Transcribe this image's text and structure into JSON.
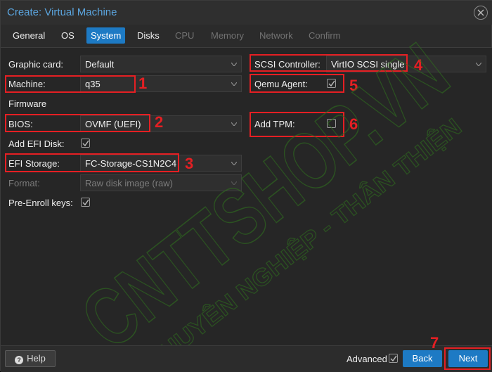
{
  "window": {
    "title": "Create: Virtual Machine"
  },
  "tabs": [
    {
      "label": "General",
      "state": "normal"
    },
    {
      "label": "OS",
      "state": "normal"
    },
    {
      "label": "System",
      "state": "active"
    },
    {
      "label": "Disks",
      "state": "normal"
    },
    {
      "label": "CPU",
      "state": "disabled"
    },
    {
      "label": "Memory",
      "state": "disabled"
    },
    {
      "label": "Network",
      "state": "disabled"
    },
    {
      "label": "Confirm",
      "state": "disabled"
    }
  ],
  "form": {
    "graphic_card": {
      "label": "Graphic card:",
      "value": "Default"
    },
    "machine": {
      "label": "Machine:",
      "value": "q35"
    },
    "firmware_heading": "Firmware",
    "bios": {
      "label": "BIOS:",
      "value": "OVMF (UEFI)"
    },
    "add_efi_disk": {
      "label": "Add EFI Disk:",
      "checked": true
    },
    "efi_storage": {
      "label": "EFI Storage:",
      "value": "FC-Storage-CS1N2C4"
    },
    "format": {
      "label": "Format:",
      "value": "Raw disk image (raw)",
      "disabled": true
    },
    "pre_enroll_keys": {
      "label": "Pre-Enroll keys:",
      "checked": true
    },
    "scsi_controller": {
      "label": "SCSI Controller:",
      "value": "VirtIO SCSI single"
    },
    "qemu_agent": {
      "label": "Qemu Agent:",
      "checked": true
    },
    "add_tpm": {
      "label": "Add TPM:",
      "checked": false
    }
  },
  "annotations": [
    "1",
    "2",
    "3",
    "4",
    "5",
    "6",
    "7"
  ],
  "watermark": {
    "line1": "CNTTSHOP.VN",
    "line2": "CHUYÊN NGHIỆP - THÂN THIỆN"
  },
  "footer": {
    "help_label": "Help",
    "advanced_label": "Advanced",
    "advanced_checked": true,
    "back_label": "Back",
    "next_label": "Next"
  },
  "colors": {
    "accent": "#1d7ac4",
    "title": "#5ba5df",
    "annotation": "#e51f23",
    "watermark": "#2f6a1f"
  }
}
